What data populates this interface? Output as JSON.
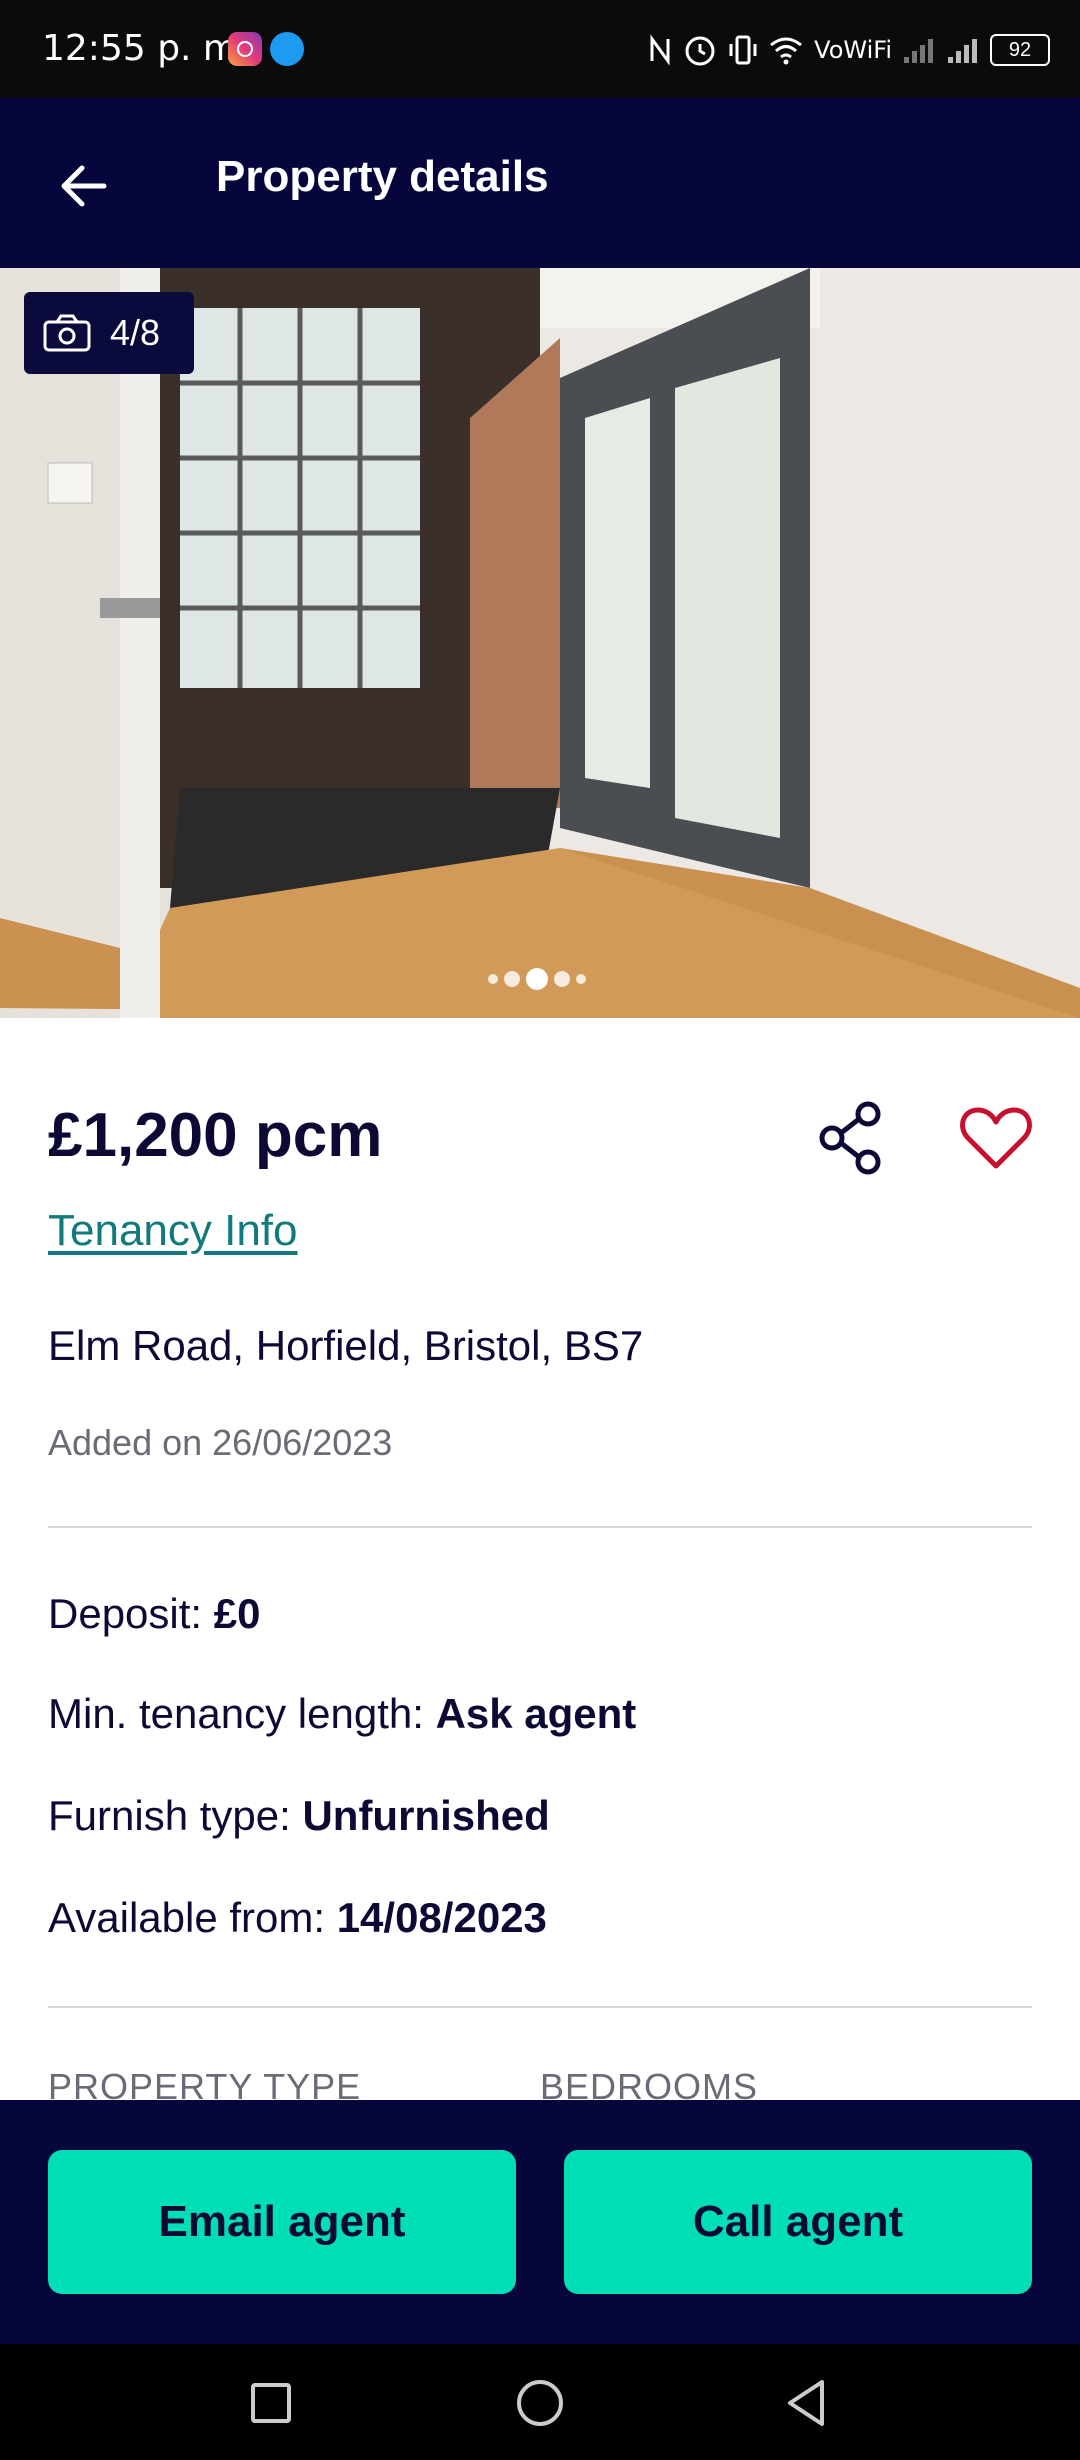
{
  "status_bar": {
    "time": "12:55 p. m.",
    "network_label": "VoWiFi",
    "battery": "92"
  },
  "header": {
    "title": "Property details"
  },
  "gallery": {
    "counter": "4/8",
    "current_index": 4,
    "total": 8
  },
  "listing": {
    "price": "£1,200 pcm",
    "tenancy_link": "Tenancy Info",
    "address": "Elm Road, Horfield, Bristol, BS7",
    "added": "Added on 26/06/2023"
  },
  "details": [
    {
      "label": "Deposit:",
      "value": "£0"
    },
    {
      "label": "Min. tenancy length:",
      "value": "Ask agent"
    },
    {
      "label": "Furnish type:",
      "value": "Unfurnished"
    },
    {
      "label": "Available from:",
      "value": "14/08/2023"
    }
  ],
  "summary": {
    "property_type_label": "PROPERTY TYPE",
    "bedrooms_label": "BEDROOMS"
  },
  "actions": {
    "email_label": "Email agent",
    "call_label": "Call agent"
  },
  "colors": {
    "header_bg": "#06063c",
    "accent_button": "#00deb6",
    "link": "#117a7a",
    "favorite": "#c8102e",
    "text_primary": "#0c0a35"
  },
  "icons": [
    "back-arrow-icon",
    "camera-icon",
    "share-icon",
    "heart-icon",
    "recents-icon",
    "home-icon",
    "back-nav-icon"
  ]
}
